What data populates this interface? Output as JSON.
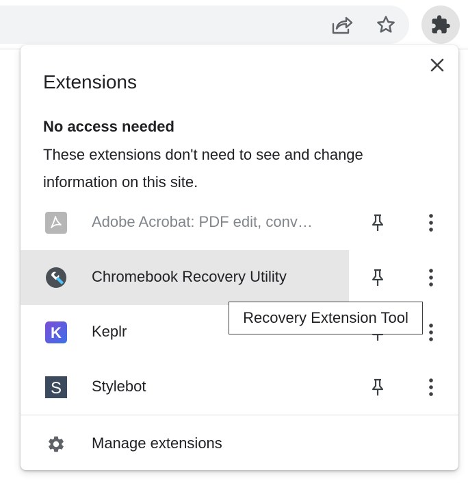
{
  "toolbar": {
    "share_icon": "share-icon",
    "bookmark_icon": "star-icon",
    "extensions_icon": "puzzle-icon"
  },
  "popup": {
    "title": "Extensions",
    "section_heading": "No access needed",
    "section_description": "These extensions don't need to see and change information on this site.",
    "extensions": [
      {
        "name": "Adobe Acrobat: PDF edit, conv…",
        "icon": "adobe-acrobat-icon",
        "disabled": true
      },
      {
        "name": "Chromebook Recovery Utility",
        "icon": "chromebook-recovery-icon",
        "hovered": true
      },
      {
        "name": "Keplr",
        "icon": "keplr-icon",
        "icon_letter": "K"
      },
      {
        "name": "Stylebot",
        "icon": "stylebot-icon",
        "icon_letter": "S"
      }
    ],
    "manage_label": "Manage extensions"
  },
  "tooltip": {
    "text": "Recovery Extension Tool"
  },
  "colors": {
    "hover_bg": "#e6e6e6",
    "keplr_gradient_start": "#7b4dd6",
    "keplr_gradient_end": "#3e6fe8",
    "stylebot_bg": "#3b4a5c",
    "icon_gray": "#5f6368"
  }
}
